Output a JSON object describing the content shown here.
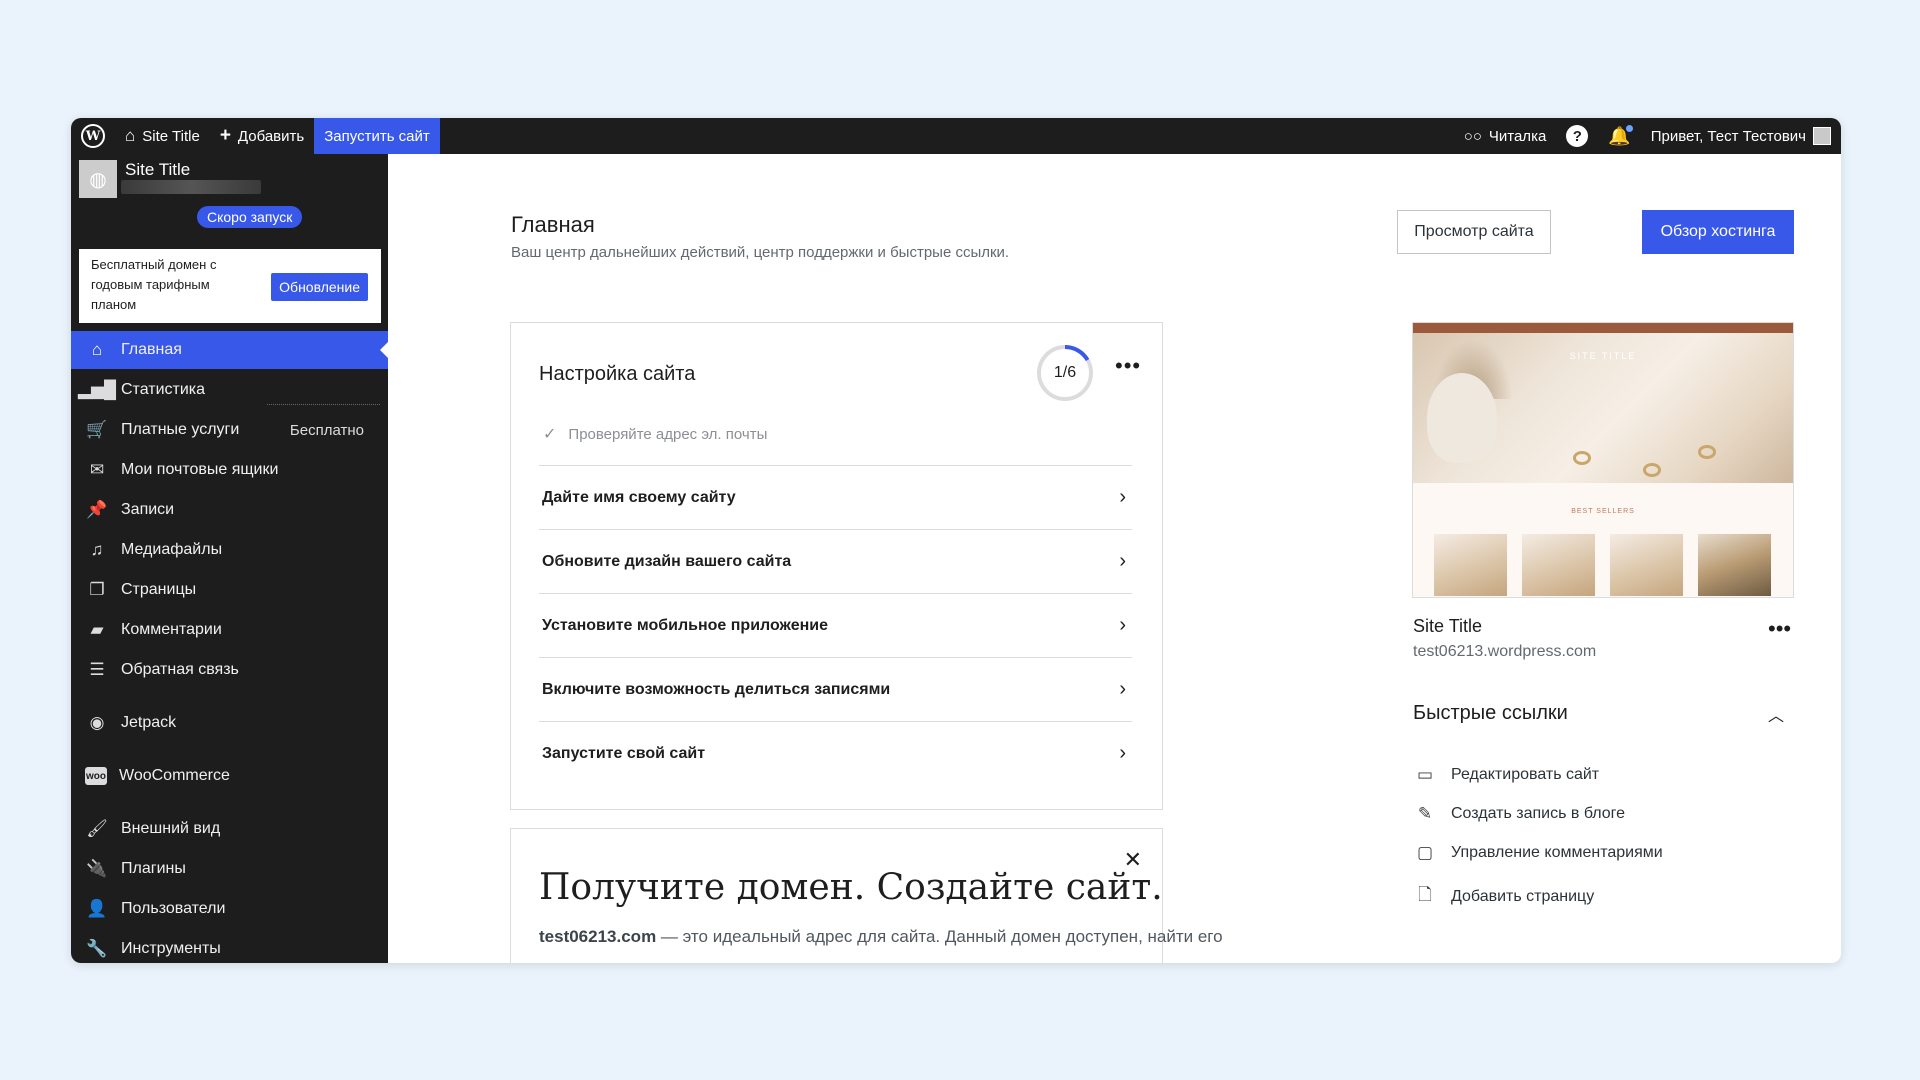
{
  "adminbar": {
    "site_title": "Site Title",
    "add_label": "Добавить",
    "launch_label": "Запустить сайт",
    "reader_label": "Читалка",
    "greeting": "Привет, Тест Тестович"
  },
  "sidebar": {
    "site_name": "Site Title",
    "soon_badge": "Скоро запуск",
    "promo": {
      "text": "Бесплатный домен с годовым тарифным планом",
      "button": "Обновление"
    },
    "items": [
      {
        "label": "Главная",
        "icon": "home-icon",
        "active": true
      },
      {
        "label": "Статистика",
        "icon": "stats-icon"
      },
      {
        "label": "Платные услуги",
        "icon": "cart-icon",
        "extra": "Бесплатно"
      },
      {
        "label": "Мои почтовые ящики",
        "icon": "mail-icon"
      },
      {
        "label": "Записи",
        "icon": "pin-icon"
      },
      {
        "label": "Медиафайлы",
        "icon": "media-icon"
      },
      {
        "label": "Страницы",
        "icon": "pages-icon"
      },
      {
        "label": "Комментарии",
        "icon": "comment-icon"
      },
      {
        "label": "Обратная связь",
        "icon": "feedback-icon"
      },
      {
        "label": "Jetpack",
        "icon": "jetpack-icon"
      },
      {
        "label": "WooCommerce",
        "icon": "woo-icon"
      },
      {
        "label": "Внешний вид",
        "icon": "brush-icon"
      },
      {
        "label": "Плагины",
        "icon": "plugin-icon"
      },
      {
        "label": "Пользователи",
        "icon": "user-icon"
      },
      {
        "label": "Инструменты",
        "icon": "tools-icon"
      }
    ]
  },
  "main": {
    "title": "Главная",
    "subtitle": "Ваш центр дальнейших действий, центр поддержки и быстрые ссылки.",
    "view_site_button": "Просмотр сайта",
    "hosting_button": "Обзор хостинга",
    "setup": {
      "title": "Настройка сайта",
      "progress_text": "1/6",
      "progress_fraction": 0.1667,
      "done_task": "Проверяйте адрес эл. почты",
      "tasks": [
        "Дайте имя своему сайту",
        "Обновите дизайн вашего сайта",
        "Установите мобильное приложение",
        "Включите возможность делиться записями",
        "Запустите свой сайт"
      ]
    },
    "domain_card": {
      "title": "Получите домен. Создайте сайт.",
      "domain": "test06213.com",
      "text": " — это идеальный адрес для сайта. Данный домен доступен, найти его"
    },
    "preview": {
      "site_title": "SITE TITLE",
      "best_sellers": "BEST SELLERS"
    },
    "site_card": {
      "title": "Site Title",
      "url": "test06213.wordpress.com"
    },
    "quick_links": {
      "title": "Быстрые ссылки",
      "items": [
        {
          "label": "Редактировать сайт",
          "icon": "laptop-icon"
        },
        {
          "label": "Создать запись в блоге",
          "icon": "pencil-icon"
        },
        {
          "label": "Управление комментариями",
          "icon": "comment-icon"
        },
        {
          "label": "Добавить страницу",
          "icon": "page-icon"
        }
      ]
    }
  }
}
